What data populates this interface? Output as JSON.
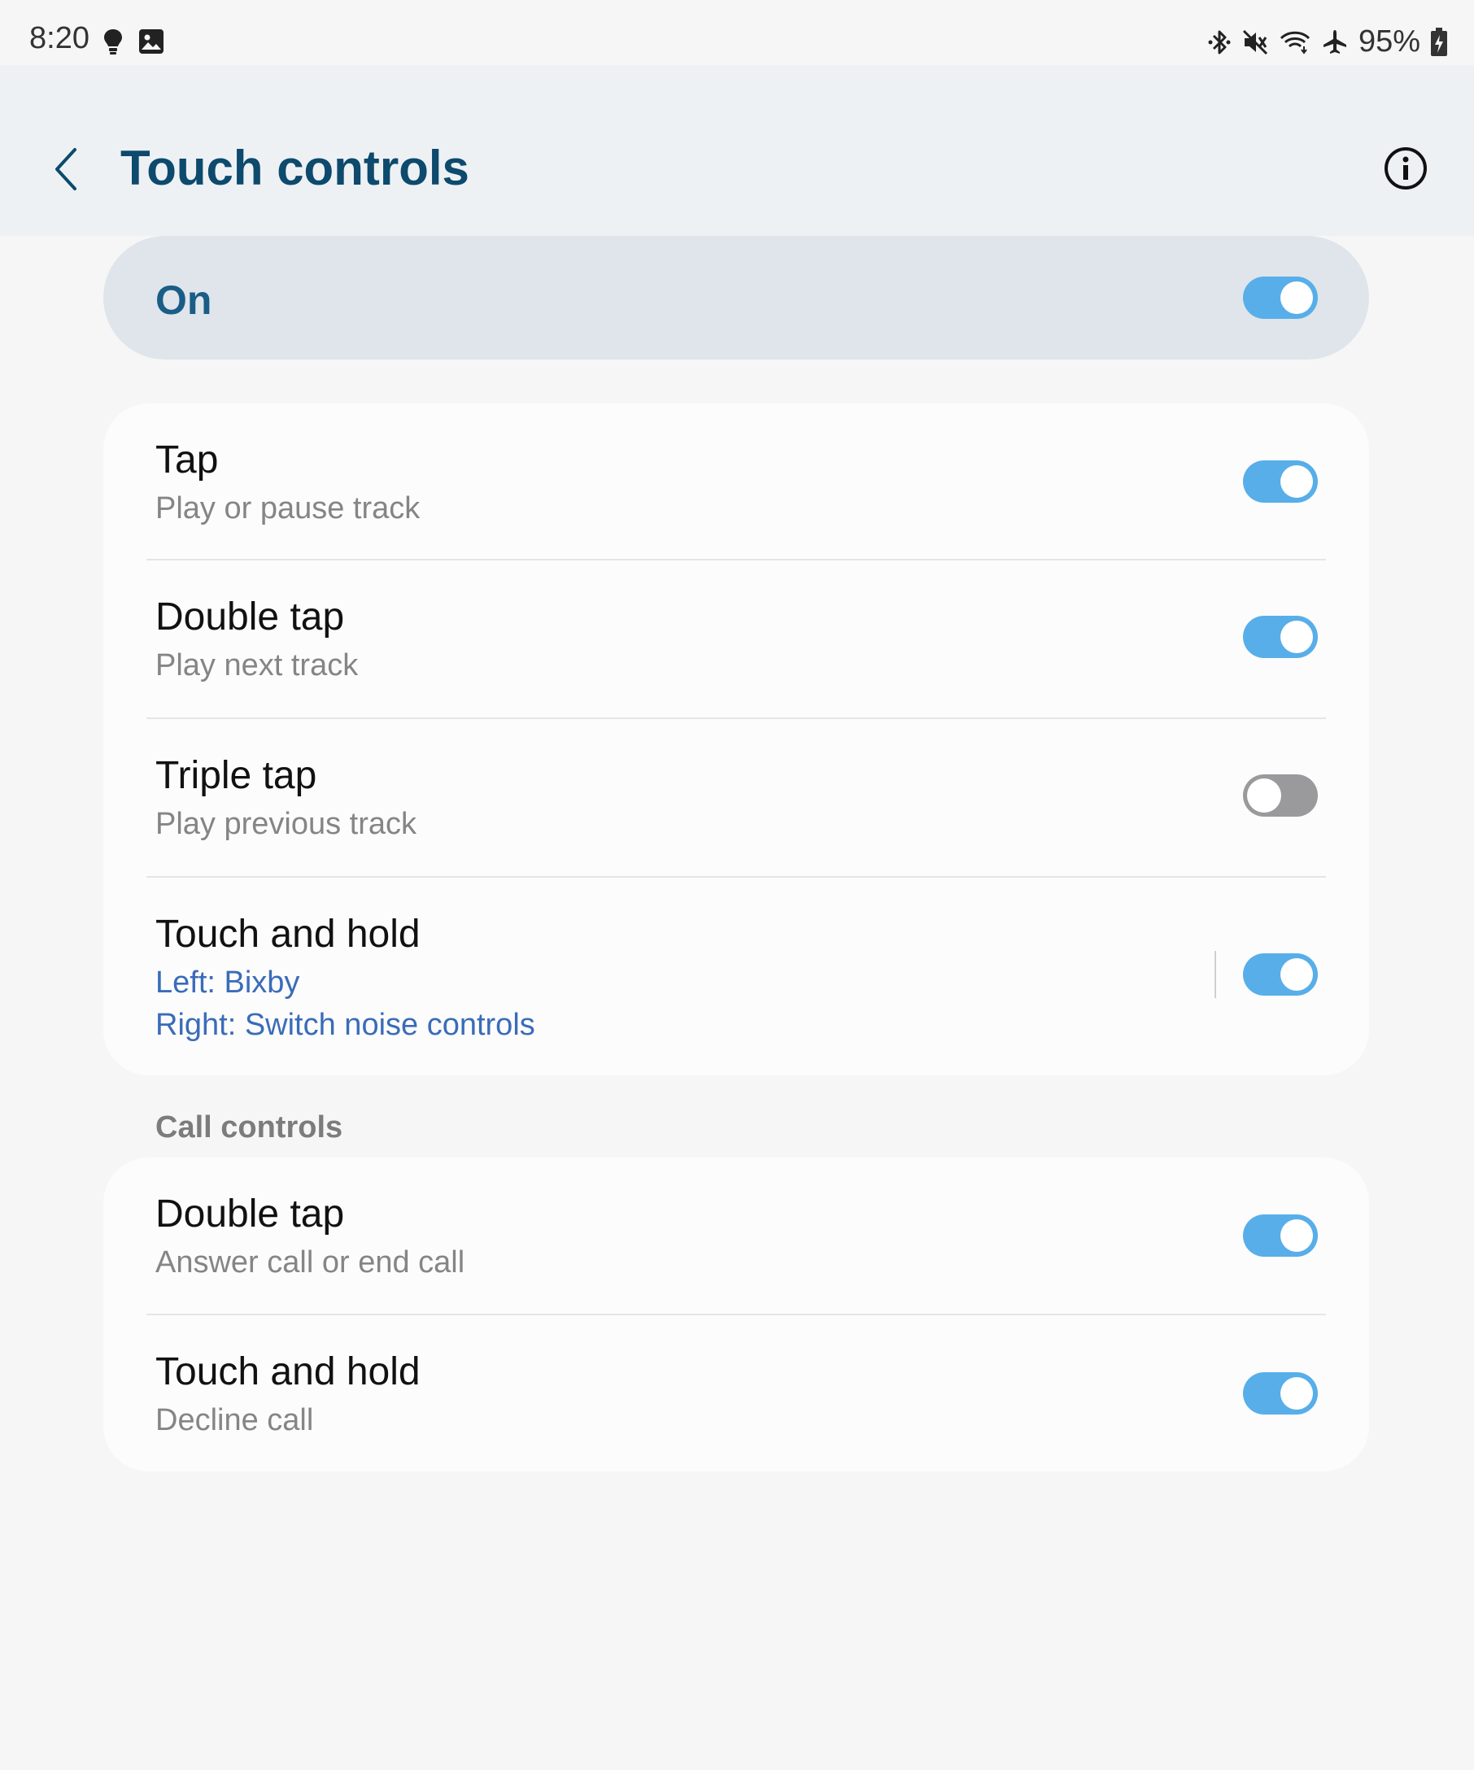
{
  "status_bar": {
    "time": "8:20",
    "left_icons": [
      "bulb-icon",
      "image-icon"
    ],
    "right_icons": [
      "bluetooth-icon",
      "mute-icon",
      "wifi-icon",
      "airplane-icon"
    ],
    "battery_text": "95%"
  },
  "app_bar": {
    "title": "Touch controls"
  },
  "master": {
    "label": "On",
    "enabled": true
  },
  "touch_controls": [
    {
      "title": "Tap",
      "subtitle": "Play or pause track",
      "enabled": true
    },
    {
      "title": "Double tap",
      "subtitle": "Play next track",
      "enabled": true
    },
    {
      "title": "Triple tap",
      "subtitle": "Play previous track",
      "enabled": false
    },
    {
      "title": "Touch and hold",
      "subtitle_left": "Left: Bixby",
      "subtitle_right": "Right: Switch noise controls",
      "enabled": true
    }
  ],
  "call_controls": {
    "header": "Call controls",
    "items": [
      {
        "title": "Double tap",
        "subtitle": "Answer call or end call",
        "enabled": true
      },
      {
        "title": "Touch and hold",
        "subtitle": "Decline call",
        "enabled": true
      }
    ]
  },
  "colors": {
    "accent": "#57aee9",
    "title": "#0d4a6d",
    "link": "#3a6cb8"
  }
}
